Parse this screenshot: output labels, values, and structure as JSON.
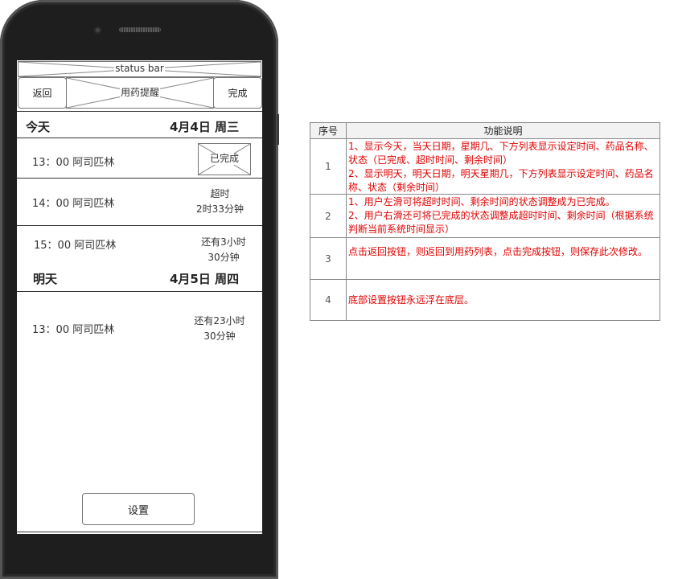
{
  "phone": {
    "status_bar": "status bar",
    "nav": {
      "back": "返回",
      "title": "用药提醒",
      "done": "完成"
    },
    "today": {
      "label": "今天",
      "date": "4月4日 周三",
      "items": [
        {
          "time_name": "13：00 阿司匹林",
          "status": "已完成"
        },
        {
          "time_name": "14：00 阿司匹林",
          "status_line1": "超时",
          "status_line2": "2时33分钟"
        },
        {
          "time_name": "15：00 阿司匹林",
          "status_line1": "还有3小时",
          "status_line2": "30分钟"
        }
      ]
    },
    "tomorrow": {
      "label": "明天",
      "date": "4月5日 周四",
      "items": [
        {
          "time_name": "13：00 阿司匹林",
          "status_line1": "还有23小时",
          "status_line2": "30分钟"
        }
      ]
    },
    "settings_button": "设置"
  },
  "spec_table": {
    "headers": [
      "序号",
      "功能说明"
    ],
    "rows": [
      {
        "num": "1",
        "lines": [
          "1、显示今天，当天日期，星期几、下方列表显示设定时间、药品名称、状态（已完成、超时时间、剩余时间）",
          "2、显示明天，明天日期，明天星期几，下方列表显示设定时间、药品名称、状态（剩余时间）"
        ]
      },
      {
        "num": "2",
        "lines": [
          "1、用户左滑可将超时时间、剩余时间的状态调整成为已完成。",
          "2、用户右滑还可将已完成的状态调整成超时时间、剩余时间（根据系统判断当前系统时间显示）"
        ]
      },
      {
        "num": "3",
        "lines": [
          "点击返回按钮，则返回到用药列表，点击完成按钮，则保存此次修改。"
        ]
      },
      {
        "num": "4",
        "lines": [
          "底部设置按钮永远浮在底层。"
        ]
      }
    ]
  },
  "colors": {
    "phone_body": "#1e1e1e",
    "annotation_text": "#e00000",
    "table_header_bg": "#f2f2f2"
  }
}
